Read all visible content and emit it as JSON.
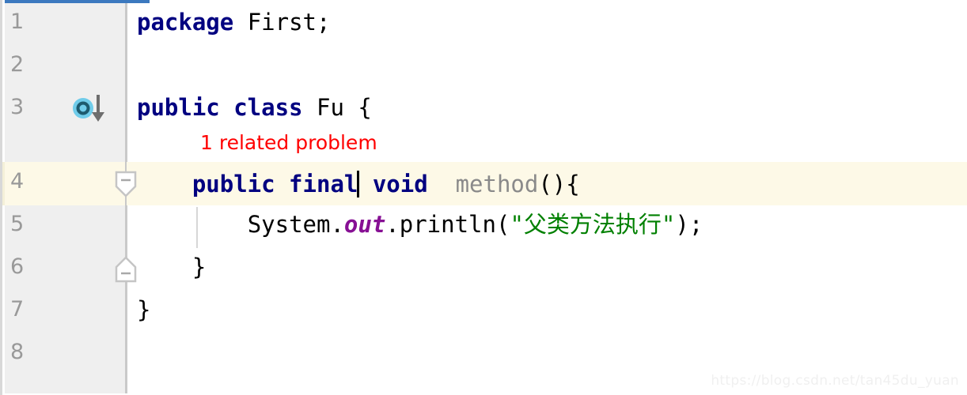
{
  "editor": {
    "app": "IntelliJ IDEA Java Editor",
    "theme_colors": {
      "gutter_bg": "#efefef",
      "editor_bg": "#ffffff",
      "current_line_highlight": "#fdf9e7",
      "keyword": "#000080",
      "string": "#008000",
      "static_field": "#871094",
      "method_name": "#8a8a8a",
      "error_hint": "#ff0000",
      "line_number": "#999999",
      "top_bar": "#3c79bf"
    },
    "line_numbers": [
      "1",
      "2",
      "3",
      "4",
      "5",
      "6",
      "7",
      "8"
    ],
    "current_line": "4",
    "lines": [
      {
        "number": "1",
        "tokens": [
          {
            "text": "package ",
            "style": "keyword"
          },
          {
            "text": "First;",
            "style": "plain"
          }
        ],
        "plain": "package First;"
      },
      {
        "number": "2",
        "tokens": [],
        "plain": ""
      },
      {
        "number": "3",
        "tokens": [
          {
            "text": "public class ",
            "style": "keyword"
          },
          {
            "text": "Fu {",
            "style": "plain"
          }
        ],
        "plain": "public class Fu {"
      },
      {
        "number": "4",
        "tokens": [
          {
            "text": "    public final",
            "style": "keyword"
          },
          {
            "text": " void ",
            "style": "keyword"
          },
          {
            "text": " method",
            "style": "method-name"
          },
          {
            "text": "(){",
            "style": "plain"
          }
        ],
        "plain": "    public final void  method(){"
      },
      {
        "number": "5",
        "tokens": [
          {
            "text": "        System.",
            "style": "plain"
          },
          {
            "text": "out",
            "style": "static-field"
          },
          {
            "text": ".println(",
            "style": "plain"
          },
          {
            "text": "\"父类方法执行\"",
            "style": "string"
          },
          {
            "text": ");",
            "style": "plain"
          }
        ],
        "plain": "        System.out.println(\"父类方法执行\");"
      },
      {
        "number": "6",
        "tokens": [
          {
            "text": "    }",
            "style": "plain"
          }
        ],
        "plain": "    }"
      },
      {
        "number": "7",
        "tokens": [
          {
            "text": "}",
            "style": "plain"
          }
        ],
        "plain": "}"
      },
      {
        "number": "8",
        "tokens": [],
        "plain": ""
      }
    ],
    "inline_hint": {
      "text": "1 related problem",
      "color": "#ff0000",
      "attached_to_line": "3"
    },
    "code_fragments": {
      "l1_kw": "package ",
      "l1_rest": "First;",
      "l3_kw": "public class ",
      "l3_rest": "Fu {",
      "l4_indent": "    ",
      "l4_kw1": "public final",
      "l4_kw2": " void ",
      "l4_method": " method",
      "l4_parens": "(){",
      "l5_indent": "        ",
      "l5_system": "System.",
      "l5_out": "out",
      "l5_println": ".println(",
      "l5_string": "\"父类方法执行\"",
      "l5_tail": ");",
      "l6": "    }",
      "l7": "}"
    },
    "gutter_icons": [
      {
        "name": "overridden-method-icon",
        "line": "3",
        "tooltip": "Method is overridden"
      },
      {
        "name": "fold-region-start-icon",
        "line": "4",
        "state": "expanded"
      },
      {
        "name": "fold-region-end-icon",
        "line": "6",
        "state": "expanded"
      }
    ],
    "caret": {
      "line": "4",
      "after_text": "final"
    },
    "watermark": "https://blog.csdn.net/tan45du_yuan"
  }
}
